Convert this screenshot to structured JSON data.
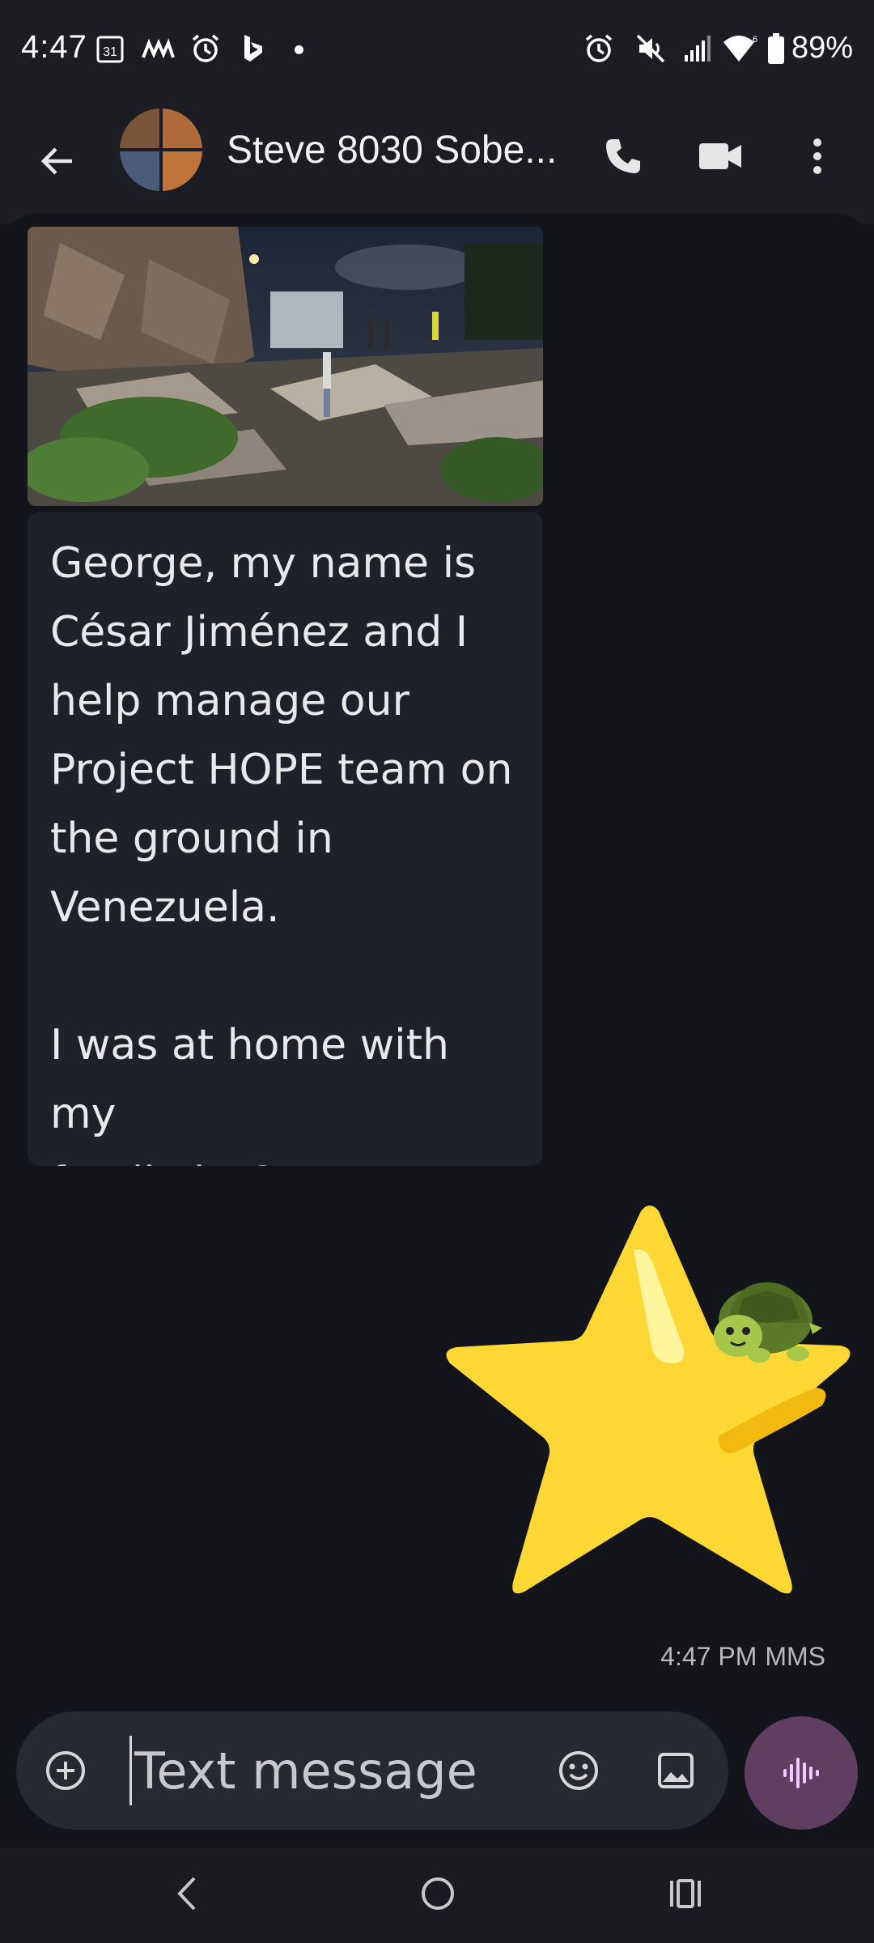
{
  "status_bar": {
    "time": "4:47",
    "battery": "89%",
    "icons": [
      "calendar-icon",
      "threads-icon",
      "alarm-icon",
      "bing-icon",
      "alarm-icon",
      "mute-vibrate-icon",
      "signal-icon",
      "wifi-icon",
      "battery-icon"
    ],
    "calendar_day": "31"
  },
  "header": {
    "contact_name": "Steve 8030 Sobe...",
    "icons": [
      "back-arrow-icon",
      "phone-icon",
      "video-call-icon",
      "more-vert-icon"
    ]
  },
  "conversation": {
    "incoming_message": {
      "text": "George, my name is\nCésar Jiménez and I\nhelp manage our\nProject HOPE team on\nthe ground in\nVenezuela.\n\nI was at home with my\nfamily in Caracas\nwhen the first"
    },
    "outgoing_sticker": {
      "icon": "star-turtle-sticker"
    },
    "meta": {
      "time": "4:47 PM",
      "type": "MMS"
    }
  },
  "compose": {
    "placeholder": "Text message",
    "icons": [
      "add-circle-icon",
      "emoji-icon",
      "gallery-icon",
      "voice-waveform-icon"
    ]
  },
  "nav_bar": {
    "icons": [
      "nav-back-icon",
      "nav-home-icon",
      "nav-recents-icon"
    ]
  },
  "colors": {
    "background": "#13151b",
    "bar": "#1b1d23",
    "bubble": "#1e2128",
    "voice_button": "#5f3e62",
    "star": "#fdd835"
  }
}
